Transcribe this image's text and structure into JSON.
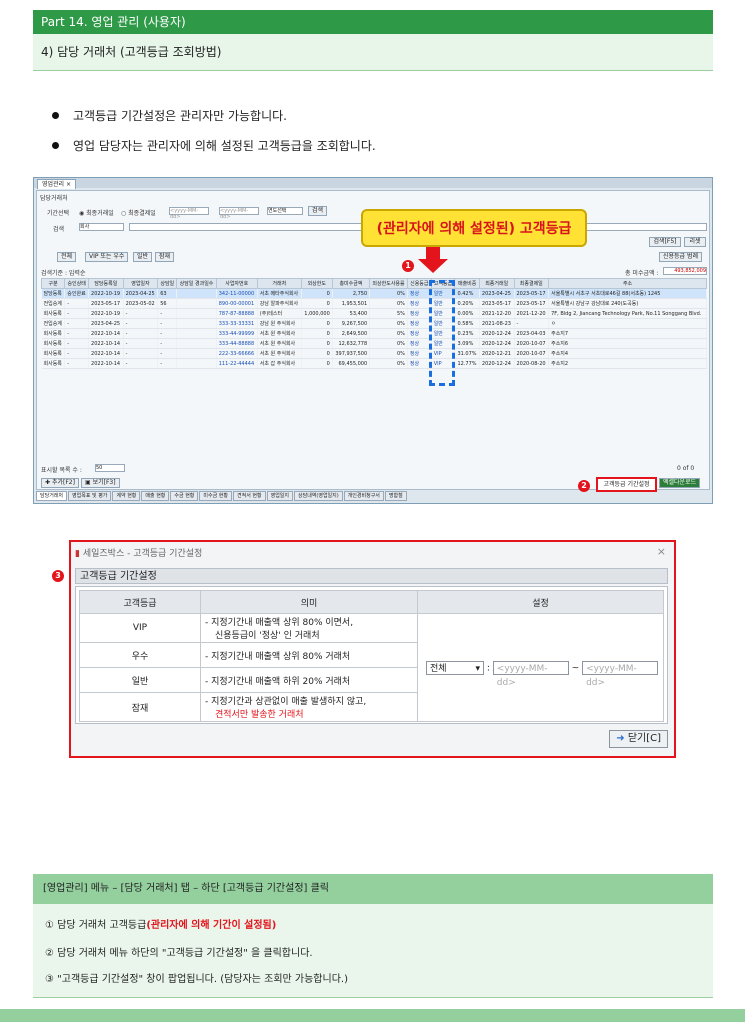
{
  "header": {
    "part_title": "Part 14. 영업 관리 (사용자)",
    "section_title": "4) 담당 거래처 (고객등급 조회방법)"
  },
  "bullets": [
    "고객등급 기간설정은 관리자만 가능합니다.",
    "영업 담당자는 관리자에 의해 설정된 고객등급을 조회합니다."
  ],
  "screen1": {
    "tab": "영업관리 ×",
    "page_title": "담당거래처",
    "period_label": "기간선택",
    "radio_1": "최종거래일",
    "radio_2": "최종결제일",
    "date_from": "<yyyy-MM-dd>",
    "date_to": "<yyyy-MM-dd>",
    "period_select": "연도선택",
    "search_label": "검색",
    "search_field": "회사",
    "search_btn": "검색",
    "search_button": "검색[F5]",
    "reset_button": "리셋",
    "filters": [
      "전체",
      "VIP 또는 우수",
      "일반",
      "잠재"
    ],
    "grade_btn": "신용등급 범례",
    "count_label": "검색기준 : 입력순",
    "total_label": "총 미수금액 :",
    "total_value": "493,852,009",
    "columns": [
      "구분",
      "승인상태",
      "담당등록일",
      "영업일자",
      "상담일",
      "상담일 경과일수",
      "사업자번호",
      "거래처",
      "외상한도",
      "총미수금액",
      "외상한도사용률",
      "신용등급",
      "고객등급",
      "매출비중",
      "최종거래일",
      "최종결제일",
      "주소"
    ],
    "rows": [
      [
        "담당등록",
        "승인완료",
        "2022-10-19",
        "2023-04-25",
        "63",
        "",
        "342-11-00000",
        "서초 메타주식회사",
        "0",
        "2,750",
        "0%",
        "정상",
        "일반",
        "0.42%",
        "2023-04-25",
        "2023-05-17",
        "서울특별시 서초구 서초대로46길 88(서초동) 1245"
      ],
      [
        "전입승계",
        "-",
        "2023-05-17",
        "2023-05-02",
        "56",
        "",
        "890-00-00001",
        "강남 알파주식회사",
        "0",
        "1,953,501",
        "0%",
        "정상",
        "일반",
        "0.20%",
        "2023-05-17",
        "2023-05-17",
        "서울특별시 강남구 강남대로 240(도곡동)"
      ],
      [
        "회사등록",
        "-",
        "2022-10-19",
        "-",
        "-",
        "",
        "787-87-88888",
        "(주)테스터",
        "1,000,000",
        "53,400",
        "5%",
        "정상",
        "일반",
        "0.00%",
        "2021-12-20",
        "2021-12-20",
        "7F, Bldg 2, Jiancang Technology Park, No.11 Songgang Blvd."
      ],
      [
        "전입승계",
        "-",
        "2023-04-25",
        "-",
        "-",
        "",
        "333-33-33331",
        "강남 원 주식회사",
        "0",
        "9,267,500",
        "0%",
        "정상",
        "일반",
        "0.58%",
        "2021-08-23",
        "-",
        "ㅇ"
      ],
      [
        "회사등록",
        "-",
        "2022-10-14",
        "-",
        "-",
        "",
        "333-44-99999",
        "서초 원 주식회사",
        "0",
        "2,649,500",
        "0%",
        "정상",
        "일반",
        "0.23%",
        "2020-12-24",
        "2023-04-03",
        "주소지7"
      ],
      [
        "회사등록",
        "-",
        "2022-10-14",
        "-",
        "-",
        "",
        "333-44-88888",
        "서초 원 주식회사",
        "0",
        "12,632,778",
        "0%",
        "정상",
        "일반",
        "3.09%",
        "2020-12-24",
        "2020-10-07",
        "주소지6"
      ],
      [
        "회사등록",
        "-",
        "2022-10-14",
        "-",
        "-",
        "",
        "222-33-66666",
        "서초 원 주식회사",
        "0",
        "397,937,500",
        "0%",
        "정상",
        "VIP",
        "31.07%",
        "2020-12-21",
        "2020-10-07",
        "주소지4"
      ],
      [
        "회사등록",
        "-",
        "2022-10-14",
        "-",
        "-",
        "",
        "111-22-44444",
        "서초 갑 주식회사",
        "0",
        "69,455,000",
        "0%",
        "정상",
        "VIP",
        "12.77%",
        "2020-12-24",
        "2020-08-20",
        "주소지2"
      ]
    ],
    "page_size_label": "표시할 목록 수 :",
    "page_size": "50",
    "pager": "0 of 0",
    "add_btn": "추가[F2]",
    "view_btn": "보기[F3]",
    "period_btn": "고객등급 기간설정",
    "excel_btn": "엑셀다운로드",
    "bottom_tabs": [
      "담당거래처",
      "영업목표 및 평가",
      "계약 현황",
      "매출 현황",
      "수금 현황",
      "미수금 현황",
      "견적서 현황",
      "영업일지",
      "상담내역(영업일지)",
      "개인경비청구서",
      "명함철"
    ]
  },
  "callout": "(관리자에 의해 설정된) 고객등급",
  "markers": [
    "1",
    "2",
    "3"
  ],
  "screen2": {
    "window_title": "세일즈박스 - 고객등급 기간설정",
    "close": "×",
    "section": "고객등급 기간설정",
    "col_grade": "고객등급",
    "col_meaning": "의미",
    "col_setting": "설정",
    "grades": [
      {
        "grade": "VIP",
        "line1": "- 지정기간내 매출액 상위 80% 이면서,",
        "line2": "신용등급이 '정상' 인 거래처"
      },
      {
        "grade": "우수",
        "line1": "- 지정기간내 매출액 상위 80% 거래처",
        "line2": ""
      },
      {
        "grade": "일반",
        "line1": "- 지정기간내 매출액 하위 20% 거래처",
        "line2": ""
      },
      {
        "grade": "잠재",
        "line1": "- 지정기간과 상관없이 매출 발생하지 않고,",
        "line2": "견적서만 발송한 거래처"
      }
    ],
    "select_value": "전체",
    "colon": ":",
    "tilde": "~",
    "date_placeholder": "<yyyy-MM-dd>",
    "close_btn": "닫기[C]"
  },
  "instructions": {
    "title": "[영업관리] 메뉴 – [담당 거래처] 탭 – 하단 [고객등급 기간설정] 클릭",
    "l1_prefix": "① 담당 거래처 고객등급",
    "l1_red": "(관리자에 의해 기간이 설정됨)",
    "l2": "② 담당 거래처 메뉴 하단의 \"고객등급 기간설정\" 을 클릭합니다.",
    "l3": "③ \"고객등급 기간설정\" 창이 팝업됩니다. (담당자는 조회만 가능합니다.)"
  }
}
